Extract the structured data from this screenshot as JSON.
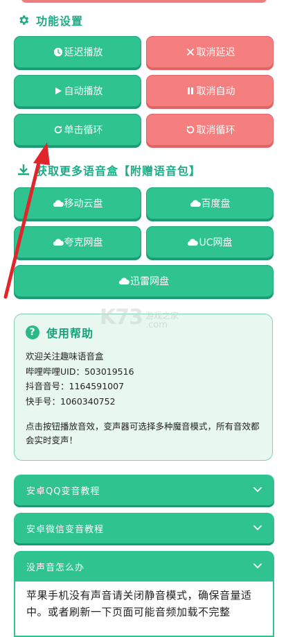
{
  "sections": {
    "features_title": "功能设置",
    "download_title": "获取更多语音盒【附赠语音包】"
  },
  "controls": {
    "delay_play": "延迟播放",
    "cancel_delay": "取消延迟",
    "auto_play": "自动播放",
    "cancel_auto": "取消自动",
    "single_loop": "单击循环",
    "cancel_loop": "取消循环"
  },
  "downloads": {
    "mobile_cloud": "移动云盘",
    "baidu": "百度盘",
    "quark": "夸克网盘",
    "uc": "UC网盘",
    "xunlei": "迅雷网盘"
  },
  "help": {
    "title": "使用帮助",
    "welcome": "欢迎关注趣味语音盒",
    "bilibili": "哔哩哔哩UID：503019516",
    "douyin": "抖音音号：1164591007",
    "kuaishou": "快手号：1060340752",
    "note": "点击按钮播放音效，变声器可选择多种魔音模式，所有音效都会实时变声！"
  },
  "accordions": {
    "android_qq": "安卓QQ变音教程",
    "android_wechat": "安卓微信变音教程",
    "no_sound": "没声音怎么办",
    "no_sound_answer": "苹果手机没有声音请关闭静音模式，确保音量适中。或者刷新一下页面可能音频加载不完整"
  },
  "watermark": {
    "brand": "K73",
    "cn": "游戏之家",
    "com": ".com"
  },
  "colors": {
    "green": "#2ec38f",
    "red": "#f57e7f",
    "title_green": "#1faa86",
    "arrow_red": "#e0262a"
  }
}
